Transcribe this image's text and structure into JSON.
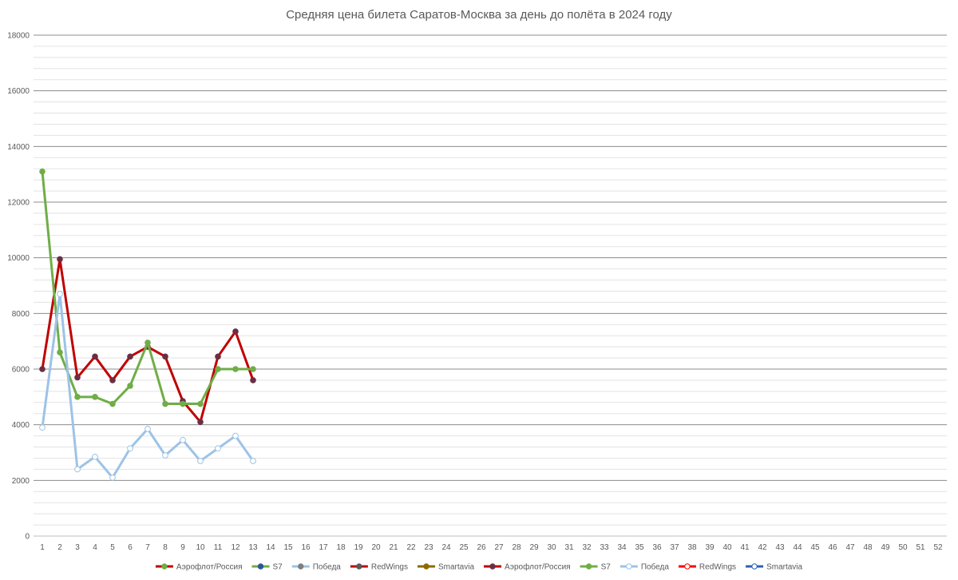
{
  "chart_data": {
    "type": "line",
    "title": "Средняя цена билета Саратов-Москва за день до полёта в 2024 году",
    "xlabel": "",
    "ylabel": "",
    "ylim": [
      0,
      18000
    ],
    "y_ticks": [
      0,
      2000,
      4000,
      6000,
      8000,
      10000,
      12000,
      14000,
      16000,
      18000
    ],
    "y_minor_step": 400,
    "categories": [
      "1",
      "2",
      "3",
      "4",
      "5",
      "6",
      "7",
      "8",
      "9",
      "10",
      "11",
      "12",
      "13",
      "14",
      "15",
      "16",
      "17",
      "18",
      "19",
      "20",
      "21",
      "22",
      "23",
      "24",
      "25",
      "26",
      "27",
      "28",
      "29",
      "30",
      "31",
      "32",
      "33",
      "34",
      "35",
      "36",
      "37",
      "38",
      "39",
      "40",
      "41",
      "42",
      "43",
      "44",
      "45",
      "46",
      "47",
      "48",
      "49",
      "50",
      "51",
      "52"
    ],
    "grid": true,
    "legend_position": "bottom",
    "series": [
      {
        "name": "Аэрофлот/Россия",
        "color": "#c00000",
        "marker": "#6b2f43",
        "marker_fill": "filled",
        "values": [
          6000,
          9950,
          5700,
          6450,
          5600,
          6450,
          6800,
          6450,
          4850,
          4100,
          6450,
          7350,
          5600
        ]
      },
      {
        "name": "S7",
        "color": "#70ad47",
        "marker": "#70ad47",
        "marker_fill": "filled",
        "values": [
          13100,
          6600,
          5000,
          5000,
          4750,
          5400,
          6950,
          4750,
          4750,
          4750,
          6000,
          6000,
          6000
        ]
      },
      {
        "name": "Победа",
        "color": "#9dc3e6",
        "marker": "#9dc3e6",
        "marker_fill": "hollow",
        "values": [
          3900,
          8700,
          2400,
          2850,
          2100,
          3150,
          3850,
          2900,
          3450,
          2700,
          3150,
          3600,
          2700
        ]
      }
    ],
    "legend": [
      {
        "name": "Аэрофлот/Россия",
        "line": "#c00000",
        "marker": "#70ad47",
        "marker_fill": "filled"
      },
      {
        "name": "S7",
        "line": "#70ad47",
        "marker": "#2e5597",
        "marker_fill": "filled"
      },
      {
        "name": "Победа",
        "line": "#9dc3e6",
        "marker": "#7f7f7f",
        "marker_fill": "filled"
      },
      {
        "name": "RedWings",
        "line": "#c00000",
        "marker": "#595959",
        "marker_fill": "filled"
      },
      {
        "name": "Smartavia",
        "line": "#8d6a00",
        "marker": "#8d6a00",
        "marker_fill": "filled"
      },
      {
        "name": "Аэрофлот/Россия",
        "line": "#c00000",
        "marker": "#6b2f43",
        "marker_fill": "filled"
      },
      {
        "name": "S7",
        "line": "#70ad47",
        "marker": "#70ad47",
        "marker_fill": "filled"
      },
      {
        "name": "Победа",
        "line": "#9dc3e6",
        "marker": "#9dc3e6",
        "marker_fill": "hollow"
      },
      {
        "name": "RedWings",
        "line": "#ff0000",
        "marker": "#ff0000",
        "marker_fill": "hollow"
      },
      {
        "name": "Smartavia",
        "line": "#2e5fb7",
        "marker": "#2e5fb7",
        "marker_fill": "hollow"
      }
    ]
  }
}
